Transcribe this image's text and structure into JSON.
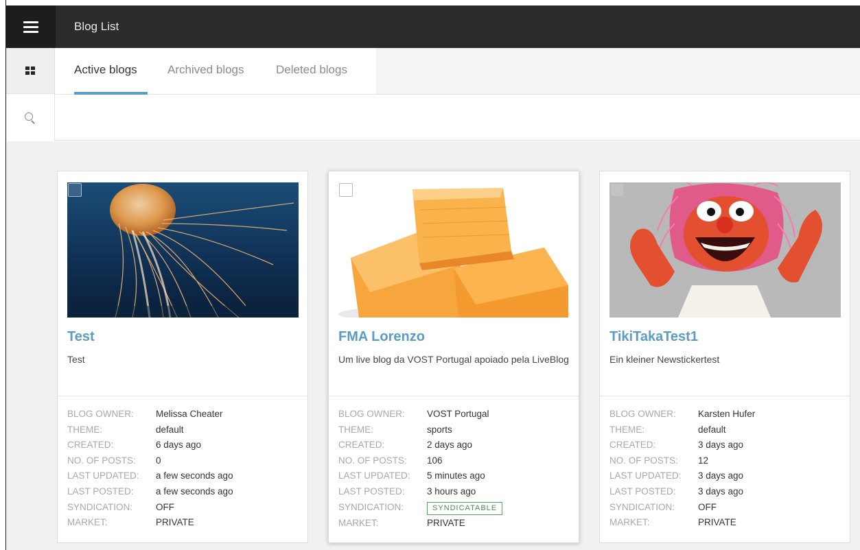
{
  "header": {
    "title": "Blog List",
    "menu_icon": "hamburger-menu-icon"
  },
  "sidebar": {
    "items": [
      {
        "icon": "grid-view-icon",
        "active": true
      },
      {
        "icon": "search-icon",
        "active": false
      }
    ]
  },
  "tabs": [
    {
      "label": "Active blogs",
      "active": true
    },
    {
      "label": "Archived blogs",
      "active": false
    },
    {
      "label": "Deleted blogs",
      "active": false
    }
  ],
  "search": {
    "value": "",
    "placeholder": ""
  },
  "meta_labels": {
    "owner": "BLOG OWNER:",
    "theme": "THEME:",
    "created": "CREATED:",
    "posts": "NO. OF POSTS:",
    "last_updated": "LAST UPDATED:",
    "last_posted": "LAST POSTED:",
    "syndication": "SYNDICATION:",
    "market": "MARKET:"
  },
  "blogs": [
    {
      "title": "Test",
      "description": "Test",
      "image": "jellyfish",
      "owner": "Melissa Cheater",
      "theme": "default",
      "created": "6 days ago",
      "posts": "0",
      "last_updated": "a few seconds ago",
      "last_posted": "a few seconds ago",
      "syndication": "OFF",
      "market": "PRIVATE"
    },
    {
      "title": "FMA Lorenzo",
      "description": "Um live blog da VOST Portugal apoiado pela LiveBlog",
      "image": "orange-candy-blocks",
      "owner": "VOST Portugal",
      "theme": "sports",
      "created": "2 days ago",
      "posts": "106",
      "last_updated": "5 minutes ago",
      "last_posted": "3 hours ago",
      "syndication": "SYNDICATABLE",
      "market": "PRIVATE"
    },
    {
      "title": "TikiTakaTest1",
      "description": "Ein kleiner Newstickertest",
      "image": "red-muppet-animal",
      "owner": "Karsten Hufer",
      "theme": "default",
      "created": "3 days ago",
      "posts": "12",
      "last_updated": "3 days ago",
      "last_posted": "3 days ago",
      "syndication": "OFF",
      "market": "PRIVATE"
    }
  ],
  "colors": {
    "accent": "#5a9cc4",
    "topbar": "#2b2b2b",
    "badge_green": "#4a8e4f"
  }
}
